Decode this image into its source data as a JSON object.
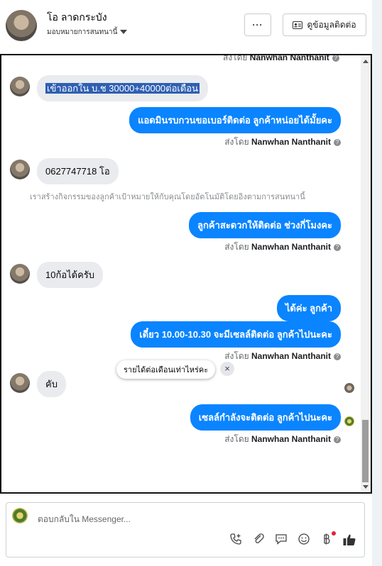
{
  "header": {
    "contact_name": "โอ ลาดกระบัง",
    "assign_label": "มอบหมายการสนทนานี้",
    "more_label": "···",
    "view_contact_label": "ดูข้อมูลติดต่อ"
  },
  "messages": {
    "top_sent_prefix": "ส่งโดย",
    "top_sent_name": "Nanwhan Nanthanit",
    "m1": "เข้าออกใน บ.ช  30000+40000ต่อเดือน",
    "m2": "แอดมินรบกวนขอเบอร์ติดต่อ ลูกค้าหน่อยได้มั้ยคะ",
    "m2_sent_prefix": "ส่งโดย",
    "m2_sent_name": "Nanwhan Nanthanit",
    "m3": "0627747718 โอ",
    "system_note": "เราสร้างกิจกรรมของลูกค้าเป้าหมายให้กับคุณโดยอัตโนมัติโดยอิงตามการสนทนานี้",
    "m4": "ลูกค้าสะดวกให้ติดต่อ ช่วงกี่โมงคะ",
    "m4_sent_prefix": "ส่งโดย",
    "m4_sent_name": "Nanwhan Nanthanit",
    "m5": "10ก้อได้ครับ",
    "m6": "ได้ค่ะ ลูกค้า",
    "m7": "เดี๋ยว 10.00-10.30 จะมีเซลล์ติดต่อ ลูกค้าไปนะคะ",
    "m7_sent_prefix": "ส่งโดย",
    "m7_sent_name": "Nanwhan Nanthanit",
    "m8": "คับ",
    "m9": "เซลล์กำลังจะติดต่อ ลูกค้าไปนะคะ",
    "m9_sent_prefix": "ส่งโดย",
    "m9_sent_name": "Nanwhan Nanthanit"
  },
  "suggestion": {
    "label": "รายได้ต่อเดือนเท่าไหร่คะ",
    "close": "×"
  },
  "composer": {
    "placeholder": "ตอบกลับใน Messenger..."
  },
  "colors": {
    "outgoing_bubble": "#0a84ff",
    "incoming_bubble": "#e9ebee",
    "highlight": "#2f5fb3"
  }
}
